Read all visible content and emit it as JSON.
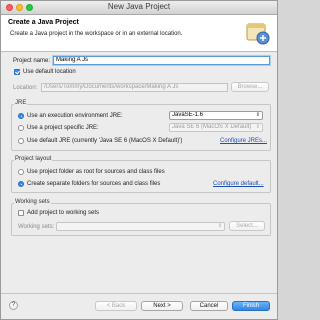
{
  "window": {
    "title": "New Java Project"
  },
  "header": {
    "title": "Create a Java Project",
    "description": "Create a Java project in the workspace or in an external location."
  },
  "project": {
    "name_label": "Project name:",
    "name_value": "Making A Js"
  },
  "location": {
    "use_default_label": "Use default location",
    "use_default_checked": true,
    "label": "Location:",
    "value": "/Users/Tommy/Documents/workspace/Making A Js",
    "browse_label": "Browse..."
  },
  "jre": {
    "group_title": "JRE",
    "options": [
      {
        "label": "Use an execution environment JRE:",
        "selected": true,
        "value": "JavaSE-1.6"
      },
      {
        "label": "Use a project specific JRE:",
        "selected": false,
        "value": "Java SE 6 (MacOS X Default)"
      },
      {
        "label": "Use default JRE (currently 'Java SE 6 (MacOS X Default)')",
        "selected": false
      }
    ],
    "configure_label": "Configure JREs..."
  },
  "layout": {
    "group_title": "Project layout",
    "options": [
      {
        "label": "Use project folder as root for sources and class files",
        "selected": false
      },
      {
        "label": "Create separate folders for sources and class files",
        "selected": true
      }
    ],
    "configure_label": "Configure default..."
  },
  "working_sets": {
    "group_title": "Working sets",
    "add_label": "Add project to working sets",
    "add_checked": false,
    "sets_label": "Working sets:",
    "select_label": "Select..."
  },
  "footer": {
    "help_label": "?",
    "back_label": "< Back",
    "next_label": "Next >",
    "cancel_label": "Cancel",
    "finish_label": "Finish"
  },
  "colors": {
    "accent": "#3b8de8",
    "link": "#1a4fb5",
    "window_bg": "#ececec"
  }
}
